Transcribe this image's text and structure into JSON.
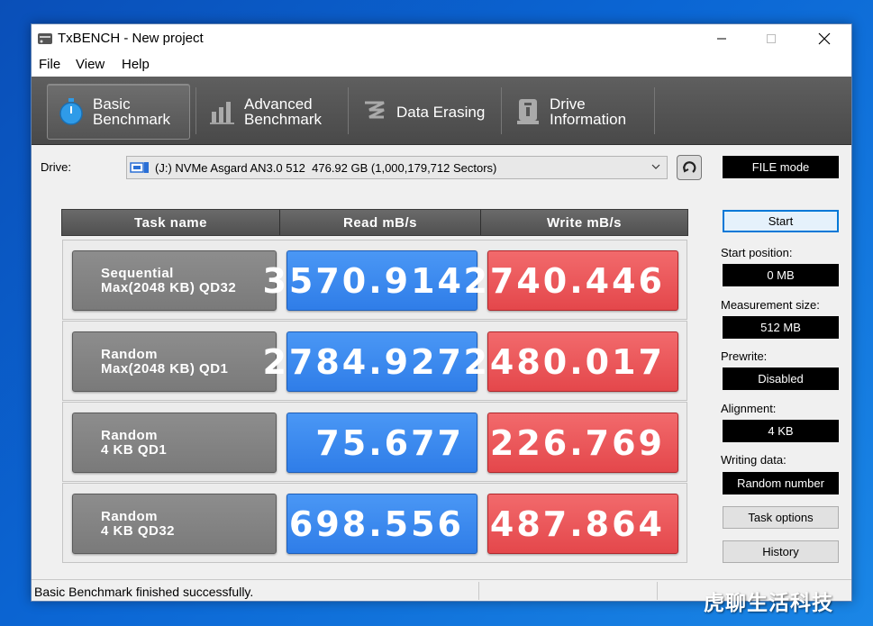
{
  "window": {
    "title": "TxBENCH - New project"
  },
  "menu": [
    "File",
    "View",
    "Help"
  ],
  "toolbar": {
    "tabs": [
      {
        "label": "Basic\nBenchmark",
        "icon": "stopwatch-icon",
        "active": true
      },
      {
        "label": "Advanced\nBenchmark",
        "icon": "bar-chart-icon",
        "active": false
      },
      {
        "label": "Data Erasing",
        "icon": "eraser-icon",
        "active": false
      },
      {
        "label": "Drive\nInformation",
        "icon": "drive-info-icon",
        "active": false
      }
    ]
  },
  "drive": {
    "label": "Drive:",
    "selected": "(J:) NVMe Asgard AN3.0 512  476.92 GB (1,000,179,712 Sectors)"
  },
  "table": {
    "headers": [
      "Task name",
      "Read mB/s",
      "Write mB/s"
    ],
    "rows": [
      {
        "line1": "Sequential",
        "line2": "Max(2048 KB) QD32",
        "read": "3570.914",
        "write": "2740.446"
      },
      {
        "line1": "Random",
        "line2": "Max(2048 KB) QD1",
        "read": "2784.927",
        "write": "2480.017"
      },
      {
        "line1": "Random",
        "line2": "4 KB QD1",
        "read": "75.677",
        "write": "226.769"
      },
      {
        "line1": "Random",
        "line2": "4 KB QD32",
        "read": "698.556",
        "write": "487.864"
      }
    ]
  },
  "panel": {
    "mode": "FILE mode",
    "start_label": "Start",
    "start_position_label": "Start position:",
    "start_position": "0 MB",
    "measurement_size_label": "Measurement size:",
    "measurement_size": "512 MB",
    "prewrite_label": "Prewrite:",
    "prewrite": "Disabled",
    "alignment_label": "Alignment:",
    "alignment": "4 KB",
    "writing_data_label": "Writing data:",
    "writing_data": "Random number",
    "task_options_label": "Task options",
    "history_label": "History"
  },
  "status": {
    "text": "Basic Benchmark finished successfully."
  },
  "watermark": "虎聊生活科技",
  "colors": {
    "read": "#3a88ef",
    "write": "#e9565a",
    "toolbar": "#555555",
    "desktop": "#0b66d4"
  }
}
